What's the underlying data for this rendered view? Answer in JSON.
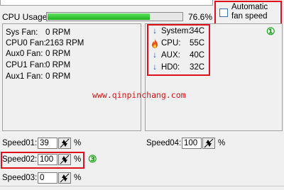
{
  "cpu": {
    "label": "CPU Usage",
    "percent_text": "76.6%",
    "percent": 76.6
  },
  "auto_fan": {
    "label": "Automatic fan speed",
    "checked": false
  },
  "fans": [
    {
      "label": "Sys Fan:",
      "value": "0 RPM"
    },
    {
      "label": "CPU0 Fan:",
      "value": "2163 RPM"
    },
    {
      "label": "Aux0 Fan:",
      "value": "0 RPM"
    },
    {
      "label": "CPU1 Fan:",
      "value": "0 RPM"
    },
    {
      "label": "Aux1 Fan:",
      "value": "0 RPM"
    }
  ],
  "temps": [
    {
      "icon": "down-arrow-icon",
      "label": "System:",
      "value": "34C"
    },
    {
      "icon": "fire-icon",
      "label": "CPU:",
      "value": "55C"
    },
    {
      "icon": "down-arrow-icon",
      "label": "AUX:",
      "value": "40C"
    },
    {
      "icon": "down-arrow-icon",
      "label": "HD0:",
      "value": "32C"
    }
  ],
  "annotations": {
    "marker1": "①",
    "marker3": "③"
  },
  "watermark": "www.qinpinchang.com",
  "speeds": [
    {
      "label": "Speed01:",
      "value": "39",
      "unit": "%"
    },
    {
      "label": "Speed02:",
      "value": "100",
      "unit": "%"
    },
    {
      "label": "Speed03:",
      "value": "0",
      "unit": "%"
    },
    {
      "label": "Speed04:",
      "value": "100",
      "unit": "%"
    }
  ],
  "colors": {
    "highlight": "#e0101a",
    "progress": "#22b422",
    "annotation_green": "#16a016",
    "arrow_blue": "#1a4fd8"
  }
}
